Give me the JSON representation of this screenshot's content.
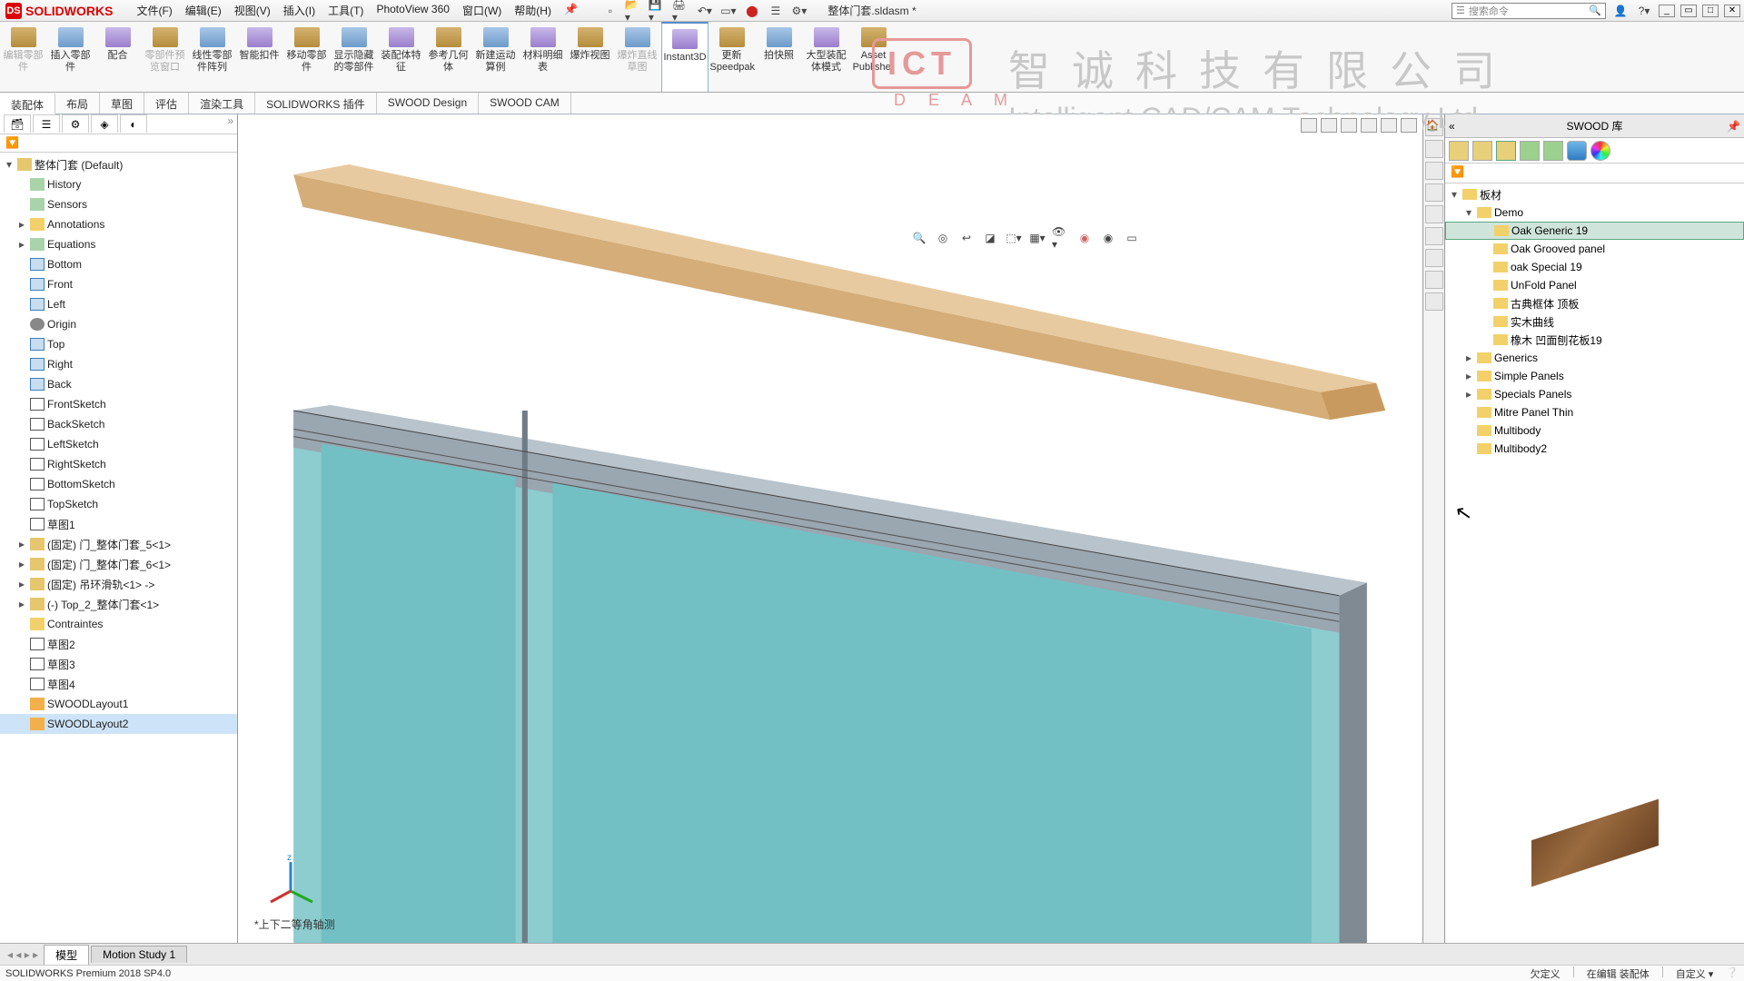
{
  "title_bar": {
    "app_name": "SOLIDWORKS",
    "document_name": "整体门套.sldasm *",
    "search_placeholder": "搜索命令"
  },
  "menu": [
    "文件(F)",
    "编辑(E)",
    "视图(V)",
    "插入(I)",
    "工具(T)",
    "PhotoView 360",
    "窗口(W)",
    "帮助(H)"
  ],
  "ribbon_buttons": [
    {
      "label": "编辑零部件",
      "dim": true
    },
    {
      "label": "插入零部件",
      "dim": false
    },
    {
      "label": "配合",
      "dim": false
    },
    {
      "label": "零部件预览窗口",
      "dim": true
    },
    {
      "label": "线性零部件阵列",
      "dim": false
    },
    {
      "label": "智能扣件",
      "dim": false
    },
    {
      "label": "移动零部件",
      "dim": false
    },
    {
      "label": "显示隐藏的零部件",
      "dim": false
    },
    {
      "label": "装配体特征",
      "dim": false
    },
    {
      "label": "参考几何体",
      "dim": false
    },
    {
      "label": "新建运动算例",
      "dim": false
    },
    {
      "label": "材料明细表",
      "dim": false
    },
    {
      "label": "爆炸视图",
      "dim": false
    },
    {
      "label": "爆炸直线草图",
      "dim": true
    },
    {
      "label": "Instant3D",
      "dim": false,
      "active": true
    },
    {
      "label": "更新Speedpak",
      "dim": false
    },
    {
      "label": "拍快照",
      "dim": false
    },
    {
      "label": "大型装配体模式",
      "dim": false
    },
    {
      "label": "Asset Publisher",
      "dim": false
    }
  ],
  "ribbon_tabs": [
    "装配体",
    "布局",
    "草图",
    "评估",
    "渲染工具",
    "SOLIDWORKS 插件",
    "SWOOD Design",
    "SWOOD CAM"
  ],
  "active_ribbon_tab": 0,
  "feature_tree": {
    "root": "整体门套  (Default)",
    "nodes": [
      {
        "t": "History",
        "ind": 2,
        "i": "i-feat",
        "exp": ""
      },
      {
        "t": "Sensors",
        "ind": 2,
        "i": "i-feat",
        "exp": ""
      },
      {
        "t": "Annotations",
        "ind": 2,
        "i": "i-fold",
        "exp": "▸"
      },
      {
        "t": "Equations",
        "ind": 2,
        "i": "i-feat",
        "exp": "▸"
      },
      {
        "t": "Bottom",
        "ind": 2,
        "i": "i-plane",
        "exp": ""
      },
      {
        "t": "Front",
        "ind": 2,
        "i": "i-plane",
        "exp": ""
      },
      {
        "t": "Left",
        "ind": 2,
        "i": "i-plane",
        "exp": ""
      },
      {
        "t": "Origin",
        "ind": 2,
        "i": "i-orig",
        "exp": ""
      },
      {
        "t": "Top",
        "ind": 2,
        "i": "i-plane",
        "exp": ""
      },
      {
        "t": "Right",
        "ind": 2,
        "i": "i-plane",
        "exp": ""
      },
      {
        "t": "Back",
        "ind": 2,
        "i": "i-plane",
        "exp": ""
      },
      {
        "t": "FrontSketch",
        "ind": 2,
        "i": "i-sk",
        "exp": ""
      },
      {
        "t": "BackSketch",
        "ind": 2,
        "i": "i-sk",
        "exp": ""
      },
      {
        "t": "LeftSketch",
        "ind": 2,
        "i": "i-sk",
        "exp": ""
      },
      {
        "t": "RightSketch",
        "ind": 2,
        "i": "i-sk",
        "exp": ""
      },
      {
        "t": "BottomSketch",
        "ind": 2,
        "i": "i-sk",
        "exp": ""
      },
      {
        "t": "TopSketch",
        "ind": 2,
        "i": "i-sk",
        "exp": ""
      },
      {
        "t": "草图1",
        "ind": 2,
        "i": "i-sk",
        "exp": ""
      },
      {
        "t": "(固定) 门_整体门套_5<1>",
        "ind": 2,
        "i": "i-part",
        "exp": "▸"
      },
      {
        "t": "(固定) 门_整体门套_6<1>",
        "ind": 2,
        "i": "i-part",
        "exp": "▸"
      },
      {
        "t": "(固定) 吊环滑轨<1> ->",
        "ind": 2,
        "i": "i-part",
        "exp": "▸"
      },
      {
        "t": "(-) Top_2_整体门套<1>",
        "ind": 2,
        "i": "i-part",
        "exp": "▸"
      },
      {
        "t": "Contraintes",
        "ind": 2,
        "i": "i-fold",
        "exp": ""
      },
      {
        "t": "草图2",
        "ind": 2,
        "i": "i-sk",
        "exp": ""
      },
      {
        "t": "草图3",
        "ind": 2,
        "i": "i-sk",
        "exp": ""
      },
      {
        "t": "草图4",
        "ind": 2,
        "i": "i-sk",
        "exp": ""
      },
      {
        "t": "SWOODLayout1",
        "ind": 2,
        "i": "i-lay",
        "exp": ""
      },
      {
        "t": "SWOODLayout2",
        "ind": 2,
        "i": "i-lay",
        "exp": "",
        "sel": true
      }
    ]
  },
  "viewport_label": "*上下二等角轴测",
  "watermark": {
    "cn": "智诚科技有限公司",
    "en": "Intelligent CAD/CAM Technology Ltd.",
    "ict": "ICT",
    "ict_sub": "D E A M"
  },
  "right_panel": {
    "title": "SWOOD 库",
    "tree": [
      {
        "t": "板材",
        "ind": 0,
        "exp": "▾",
        "i": "fold-ico"
      },
      {
        "t": "Demo",
        "ind": 1,
        "exp": "▾",
        "i": "fold-ico"
      },
      {
        "t": "Oak Generic 19",
        "ind": 2,
        "exp": "",
        "i": "fold-ico",
        "sel": true
      },
      {
        "t": "Oak Grooved panel",
        "ind": 2,
        "exp": "",
        "i": "fold-ico"
      },
      {
        "t": "oak Special 19",
        "ind": 2,
        "exp": "",
        "i": "fold-ico"
      },
      {
        "t": "UnFold Panel",
        "ind": 2,
        "exp": "",
        "i": "fold-ico"
      },
      {
        "t": "古典框体 顶板",
        "ind": 2,
        "exp": "",
        "i": "fold-ico"
      },
      {
        "t": "实木曲线",
        "ind": 2,
        "exp": "",
        "i": "fold-ico"
      },
      {
        "t": "橡木 凹面刨花板19",
        "ind": 2,
        "exp": "",
        "i": "fold-ico"
      },
      {
        "t": "Generics",
        "ind": 1,
        "exp": "▸",
        "i": "fold-ico"
      },
      {
        "t": "Simple Panels",
        "ind": 1,
        "exp": "▸",
        "i": "fold-ico"
      },
      {
        "t": "Specials Panels",
        "ind": 1,
        "exp": "▸",
        "i": "fold-ico"
      },
      {
        "t": "Mitre Panel Thin",
        "ind": 1,
        "exp": "",
        "i": "fold-ico"
      },
      {
        "t": "Multibody",
        "ind": 1,
        "exp": "",
        "i": "fold-ico"
      },
      {
        "t": "Multibody2",
        "ind": 1,
        "exp": "",
        "i": "fold-ico"
      }
    ]
  },
  "doc_tabs": [
    "模型",
    "Motion Study 1"
  ],
  "status": {
    "left": "SOLIDWORKS Premium 2018 SP4.0",
    "right": [
      "欠定义",
      "在编辑 装配体",
      "自定义  ▾"
    ]
  }
}
